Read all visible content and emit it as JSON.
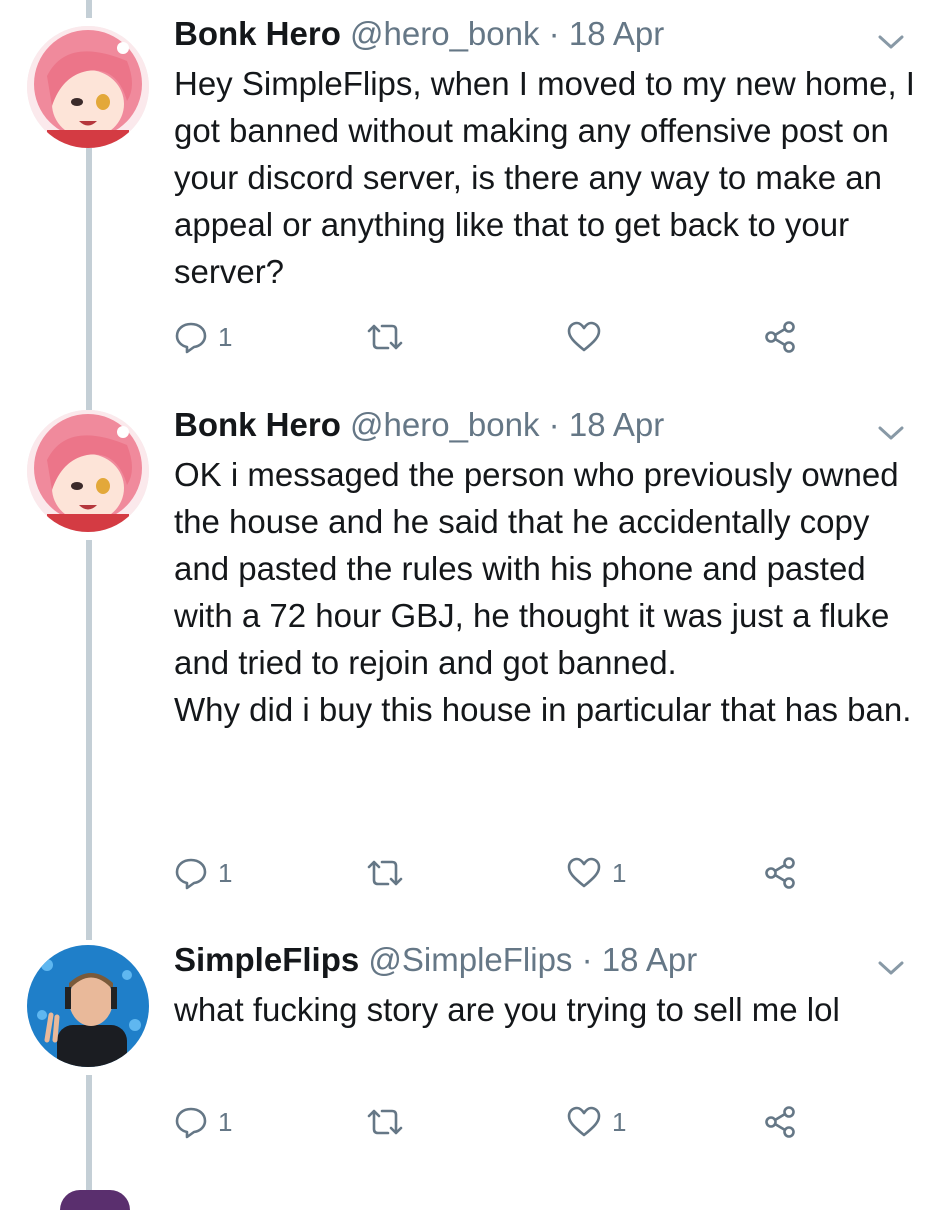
{
  "tweets": [
    {
      "name": "Bonk Hero",
      "handle": "@hero_bonk",
      "separator": "·",
      "time": "18 Apr",
      "paragraphs": [
        "Hey SimpleFlips, when I moved to my new home, I got banned without making any offensive post on your discord server, is there any way to make an appeal or anything like that to get back to your server?"
      ],
      "reply_count": "1",
      "retweet_count": "",
      "like_count": ""
    },
    {
      "name": "Bonk Hero",
      "handle": "@hero_bonk",
      "separator": "·",
      "time": "18 Apr",
      "paragraphs": [
        "OK i messaged the person who previously owned the house and he said that he accidentally copy and pasted the rules with his phone and pasted with a 72 hour GBJ, he thought it was just a fluke and tried to rejoin and got banned.",
        "Why did i buy this house in particular that has ban."
      ],
      "reply_count": "1",
      "retweet_count": "",
      "like_count": "1"
    },
    {
      "name": "SimpleFlips",
      "handle": "@SimpleFlips",
      "separator": "·",
      "time": "18 Apr",
      "paragraphs": [
        "what fucking story are you trying to sell me lol"
      ],
      "reply_count": "1",
      "retweet_count": "",
      "like_count": "1"
    }
  ],
  "icons": {
    "reply": "reply-icon",
    "retweet": "retweet-icon",
    "like": "heart-icon",
    "share": "share-icon",
    "caret": "chevron-down-icon"
  },
  "colors": {
    "text": "#14171a",
    "muted": "#657786",
    "thread_line": "#c4cfd6"
  }
}
